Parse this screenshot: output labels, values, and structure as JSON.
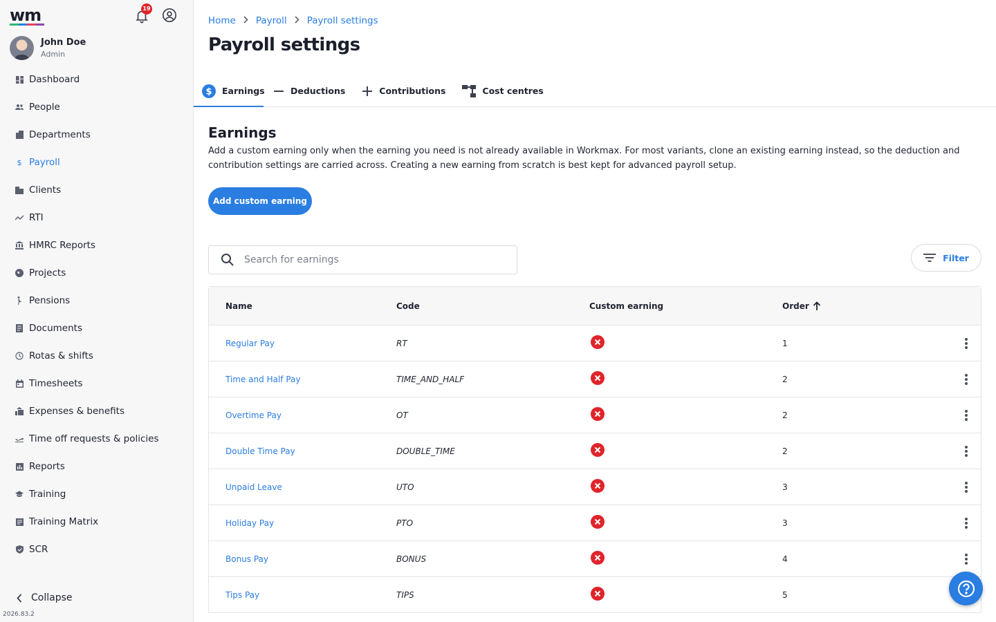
{
  "colors": {
    "accent": "#2a7de1",
    "danger": "#e0242a",
    "logo_bar": [
      "#2bb673",
      "#2a7de1",
      "#e8415f",
      "#8e44ad"
    ]
  },
  "app": {
    "logo": "wm",
    "notifications_count": "19",
    "version": "2026.83.2"
  },
  "user": {
    "name": "John Doe",
    "role": "Admin"
  },
  "sidebar": {
    "items": [
      {
        "label": "Dashboard",
        "icon": "dashboard-icon"
      },
      {
        "label": "People",
        "icon": "people-icon"
      },
      {
        "label": "Departments",
        "icon": "building-icon"
      },
      {
        "label": "Payroll",
        "icon": "dollar-icon",
        "active": true
      },
      {
        "label": "Clients",
        "icon": "clients-icon"
      },
      {
        "label": "RTI",
        "icon": "trend-icon"
      },
      {
        "label": "HMRC Reports",
        "icon": "bank-icon"
      },
      {
        "label": "Projects",
        "icon": "globe-icon"
      },
      {
        "label": "Pensions",
        "icon": "elderly-icon"
      },
      {
        "label": "Documents",
        "icon": "document-icon"
      },
      {
        "label": "Rotas & shifts",
        "icon": "clock-icon"
      },
      {
        "label": "Timesheets",
        "icon": "calendar-icon"
      },
      {
        "label": "Expenses & benefits",
        "icon": "receipt-icon"
      },
      {
        "label": "Time off requests & policies",
        "icon": "plane-icon"
      },
      {
        "label": "Reports",
        "icon": "chart-icon"
      },
      {
        "label": "Training",
        "icon": "graduation-icon"
      },
      {
        "label": "Training Matrix",
        "icon": "matrix-icon"
      },
      {
        "label": "SCR",
        "icon": "shield-icon"
      }
    ],
    "collapse_label": "Collapse"
  },
  "breadcrumb": {
    "items": [
      "Home",
      "Payroll",
      "Payroll settings"
    ]
  },
  "page": {
    "title": "Payroll settings"
  },
  "tabs": [
    {
      "label": "Earnings",
      "icon": "dollar-circle-icon",
      "active": true
    },
    {
      "label": "Deductions",
      "icon": "minus-icon"
    },
    {
      "label": "Contributions",
      "icon": "plus-icon"
    },
    {
      "label": "Cost centres",
      "icon": "hierarchy-icon"
    }
  ],
  "earnings": {
    "title": "Earnings",
    "description": "Add a custom earning only when the earning you need is not already available in Workmax. For most variants, clone an existing earning instead, so the deduction and contribution settings are carried across. Creating a new earning from scratch is best kept for advanced payroll setup.",
    "add_button": "Add custom earning",
    "search_placeholder": "Search for earnings",
    "filter_label": "Filter"
  },
  "table": {
    "columns": [
      "Name",
      "Code",
      "Custom earning",
      "Order"
    ],
    "rows": [
      {
        "name": "Regular Pay",
        "code": "RT",
        "custom": false,
        "order": "1"
      },
      {
        "name": "Time and Half Pay",
        "code": "TIME_AND_HALF",
        "custom": false,
        "order": "2"
      },
      {
        "name": "Overtime Pay",
        "code": "OT",
        "custom": false,
        "order": "2"
      },
      {
        "name": "Double Time Pay",
        "code": "DOUBLE_TIME",
        "custom": false,
        "order": "2"
      },
      {
        "name": "Unpaid Leave",
        "code": "UTO",
        "custom": false,
        "order": "3"
      },
      {
        "name": "Holiday Pay",
        "code": "PTO",
        "custom": false,
        "order": "3"
      },
      {
        "name": "Bonus Pay",
        "code": "BONUS",
        "custom": false,
        "order": "4"
      },
      {
        "name": "Tips Pay",
        "code": "TIPS",
        "custom": false,
        "order": "5"
      }
    ]
  }
}
